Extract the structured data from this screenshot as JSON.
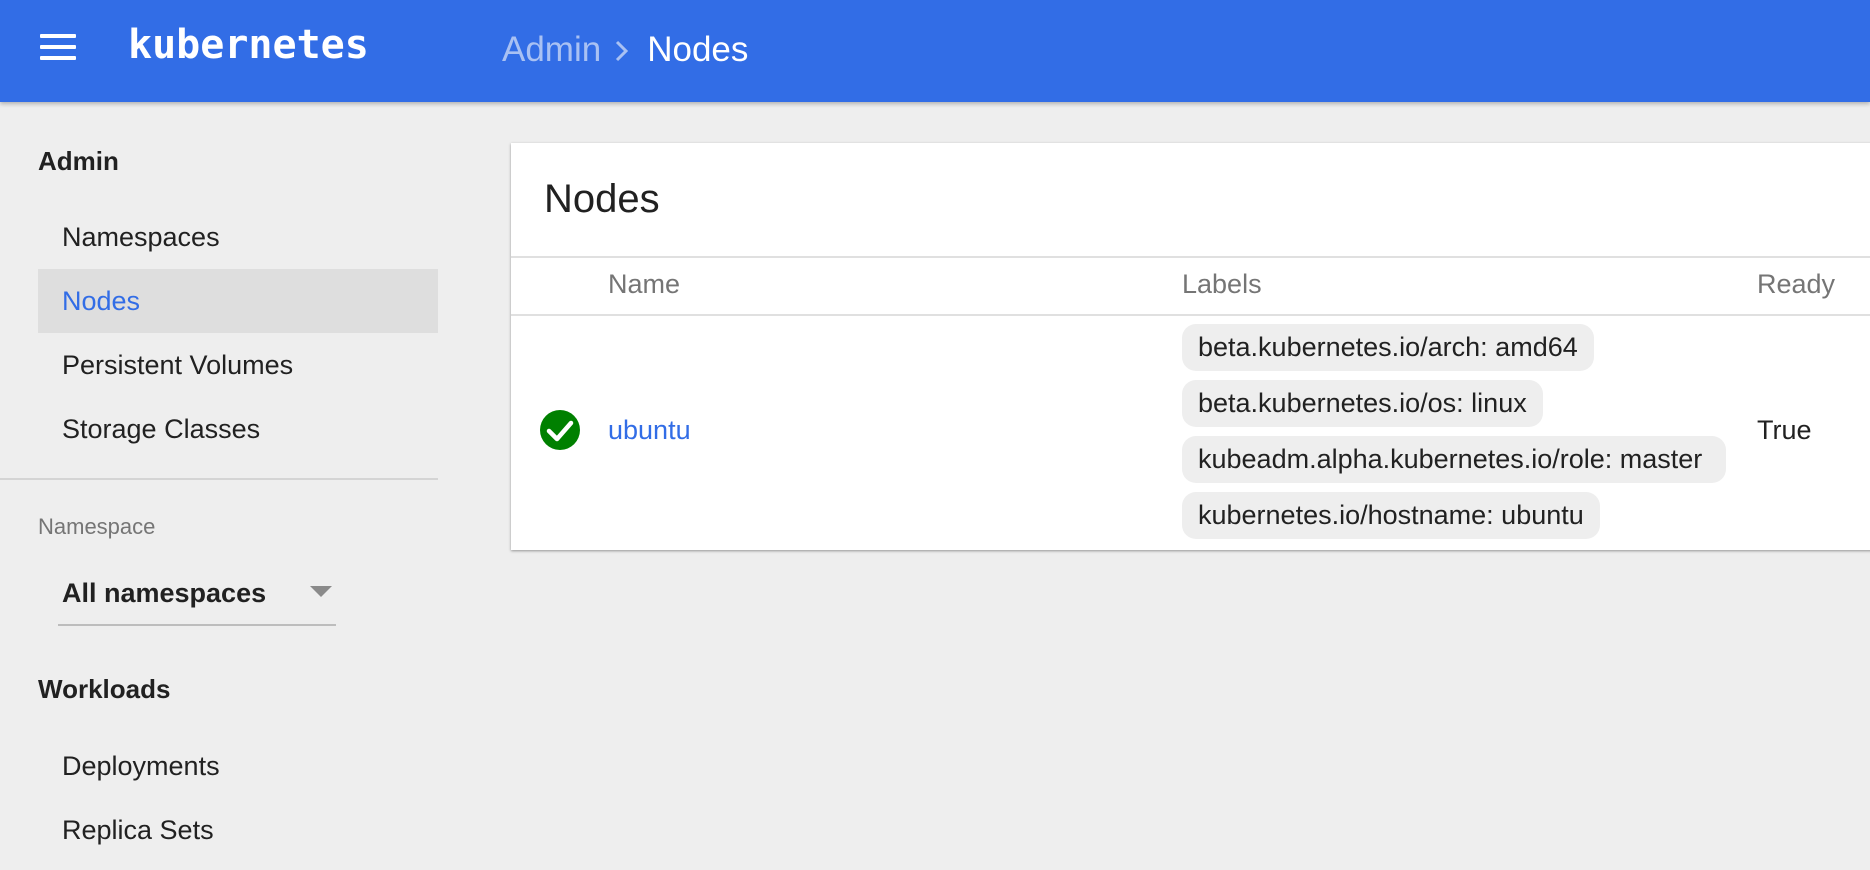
{
  "toolbar": {
    "brand": "kubernetes",
    "breadcrumb": {
      "parent": "Admin",
      "current": "Nodes"
    }
  },
  "sidebar": {
    "admin_heading": "Admin",
    "admin_items": [
      {
        "label": "Namespaces"
      },
      {
        "label": "Nodes",
        "active": true
      },
      {
        "label": "Persistent Volumes"
      },
      {
        "label": "Storage Classes"
      }
    ],
    "namespace_label": "Namespace",
    "namespace_selected": "All namespaces",
    "workloads_heading": "Workloads",
    "workload_items": [
      {
        "label": "Deployments"
      },
      {
        "label": "Replica Sets"
      }
    ]
  },
  "main": {
    "title": "Nodes",
    "columns": [
      "Name",
      "Labels",
      "Ready"
    ],
    "rows": [
      {
        "status": "check-circle-icon",
        "name": "ubuntu",
        "labels": [
          "beta.kubernetes.io/arch: amd64",
          "beta.kubernetes.io/os: linux",
          "kubeadm.alpha.kubernetes.io/role: master",
          "kubernetes.io/hostname: ubuntu"
        ],
        "ready": "True"
      }
    ]
  },
  "colors": {
    "primary": "#326de6",
    "breadcrumb_link": "#a9c1f3",
    "background": "#eeeeee",
    "success": "#008000",
    "active_nav_bg": "#dedede"
  }
}
